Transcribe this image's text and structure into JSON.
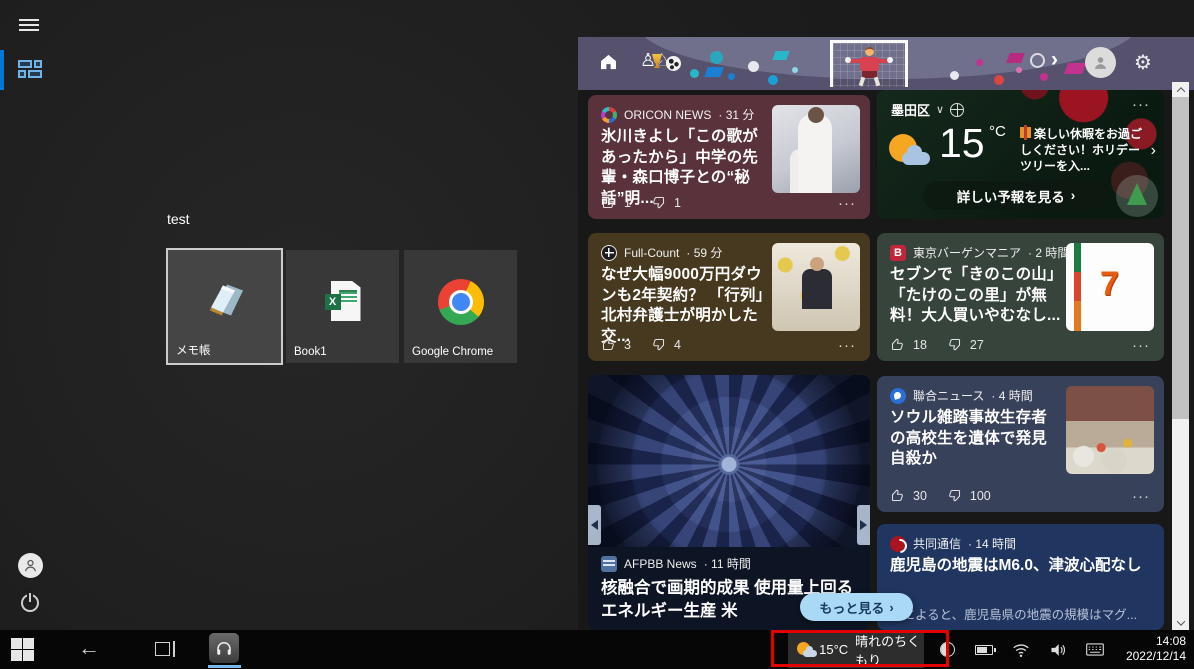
{
  "colors": {
    "accent_blue": "#0078d7",
    "highlight_red": "#e50000",
    "more_button_bg": "#a9d9f5"
  },
  "icons": {
    "ellipsis": "···",
    "chevron_right": "›",
    "chevron_down": "∨",
    "back_arrow": "←",
    "games_glyph": "♙♘",
    "gear_glyph": "⚙",
    "excel_x": "X",
    "bargain_b": "B",
    "seven_7": "7"
  },
  "start": {
    "group_label": "test",
    "tiles": [
      {
        "label": "メモ帳"
      },
      {
        "label": "Book1"
      },
      {
        "label": "Google Chrome"
      }
    ]
  },
  "news": {
    "more_label": "もっと見る",
    "cards": [
      {
        "source": "ORICON NEWS",
        "age": "31 分",
        "title": "氷川きよし「この歌があったから」中学の先輩・森口博子との“秘話”明...",
        "likes": "1",
        "dislikes": "1"
      },
      {
        "location": "墨田区",
        "temp": "15",
        "unit": "°C",
        "promo": "楽しい休暇をお過ごしください！ホリデーツリーを入...",
        "cta": "詳しい予報を見る"
      },
      {
        "source": "Full-Count",
        "age": "59 分",
        "title": "なぜ大幅9000万円ダウンも2年契約？ 「行列」北村弁護士が明かした交...",
        "likes": "3",
        "dislikes": "4"
      },
      {
        "source": "東京バーゲンマニア",
        "age": "2 時間",
        "title": "セブンで「きのこの山」「たけのこの里」が無料！大人買いやむなし...",
        "likes": "18",
        "dislikes": "27"
      },
      {
        "source": "聯合ニュース",
        "age": "4 時間",
        "title": "ソウル雑踏事故生存者の高校生を遺体で発見 自殺か",
        "likes": "30",
        "dislikes": "100"
      },
      {
        "source": "AFPBB News",
        "age": "11 時間",
        "title": "核融合で画期的成果 使用量上回るエネルギー生産 米"
      },
      {
        "source": "共同通信",
        "age": "14 時間",
        "title": "鹿児島の地震はM6.0、津波心配なし",
        "snippet": "…によると、鹿児島県の地震の規模はマグ..."
      }
    ]
  },
  "taskbar": {
    "weather": {
      "temp": "15°C",
      "condition": "晴れのちくもり"
    },
    "clock": {
      "time": "14:08",
      "date": "2022/12/14"
    }
  }
}
